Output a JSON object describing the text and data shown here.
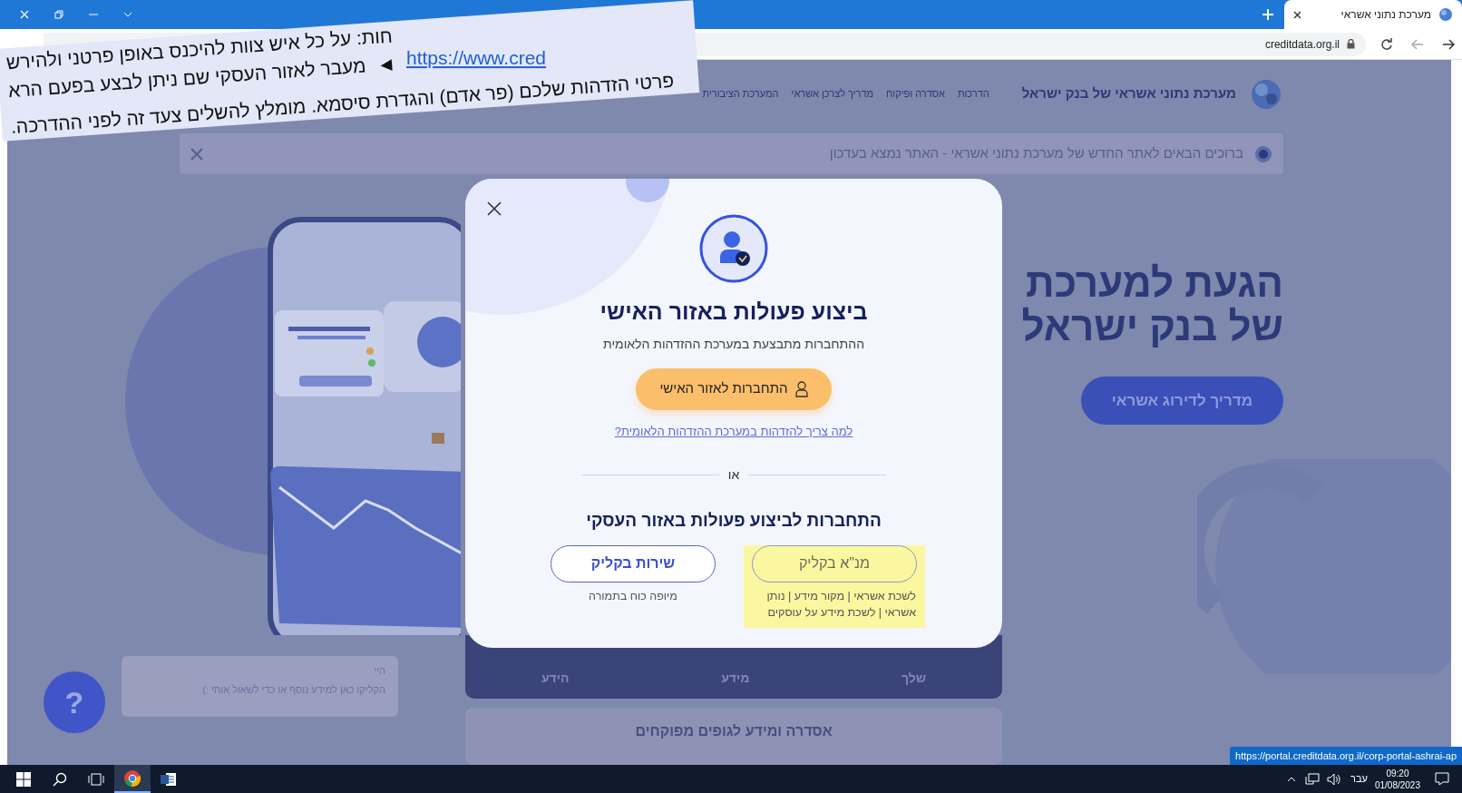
{
  "browser": {
    "tab": {
      "title": "מערכת נתוני אשראי",
      "selected": true
    },
    "address": "creditdata.org.il",
    "status_url": "https://portal.creditdata.org.il/corp-portal-ashrai-ap"
  },
  "site": {
    "logo_text": "מערכת נתוני אשראי של בנק ישראל",
    "nav": [
      "הדרכות",
      "אסדרה ופיקוח",
      "מדריך לצרכן אשראי",
      "המערכת הציבורית"
    ],
    "banner": "ברוכים הבאים לאתר החדש של מערכת נתוני אשראי - האתר נמצא בעדכון",
    "hero": {
      "title_lines": [
        "הגעת למערכת",
        "של בנק ישראל"
      ],
      "button": "מדריך לדירוג אשראי"
    },
    "cards": [
      "שלך",
      "מידע",
      "הידע"
    ],
    "section_title": "אסדרה ומידע לגופים מפוקחים",
    "help_button": "?",
    "chat": {
      "greeting": "היי",
      "message": "הקליקו כאן למידע נוסף או כדי לשאול אותי :)"
    }
  },
  "modal": {
    "title": "ביצוע פעולות באזור האישי",
    "subtitle": "ההתחברות מתבצעת במערכת ההזדהות הלאומית",
    "primary_button": "התחברות לאזור האישי",
    "help_link": "למה צריך להזדהות במערכת ההזדהות הלאומית?",
    "divider": "או",
    "business_title": "התחברות לביצוע פעולות באזור העסקי",
    "options": [
      {
        "label": "מנ\"א בקליק",
        "note": "לשכת אשראי | מקור מידע | נותן אשראי | לשכת מידע על עוסקים",
        "highlighted": true
      },
      {
        "label": "שירות בקליק",
        "note": "מיופה כוח בתמורה",
        "highlighted": false
      }
    ]
  },
  "note": {
    "line_1": "חות: על כל איש צוות להיכנס באופן פרטני ולהירש",
    "link": "https://www.cred",
    "arrow": "◄",
    "line_2": "מעבר לאזור העסקי שם ניתן לבצע בפעם הרא",
    "line_3": "פרטי הזדהות שלכם (פר אדם) והגדרת סיסמא. מומלץ להשלים צעד זה לפני ההדרכה."
  },
  "taskbar": {
    "language": "עבר",
    "time": "09:20",
    "date": "01/08/2023"
  }
}
